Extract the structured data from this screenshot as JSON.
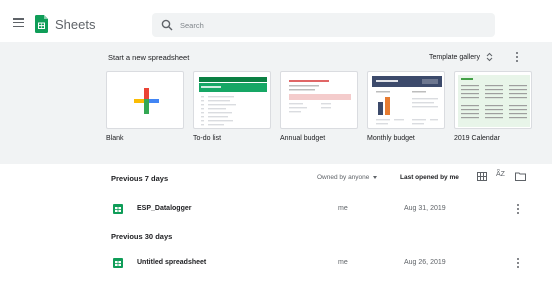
{
  "header": {
    "app_title": "Sheets",
    "search_placeholder": "Search",
    "icons": [
      "menu-icon",
      "sheets-logo-icon",
      "search-icon"
    ]
  },
  "templates": {
    "heading": "Start a new spreadsheet",
    "gallery_label": "Template gallery",
    "items": [
      {
        "label": "Blank",
        "icon": "plus-icon"
      },
      {
        "label": "To-do list"
      },
      {
        "label": "Annual budget"
      },
      {
        "label": "Monthly budget"
      },
      {
        "label": "2019 Calendar"
      }
    ]
  },
  "recent": {
    "owner_filter": "Owned by anyone",
    "sort_label": "Last opened by me",
    "sections": [
      {
        "title": "Previous 7 days",
        "files": [
          {
            "name": "ESP_Datalogger",
            "owner": "me",
            "date": "Aug 31, 2019"
          }
        ]
      },
      {
        "title": "Previous 30 days",
        "files": [
          {
            "name": "Untitled spreadsheet",
            "owner": "me",
            "date": "Aug 26, 2019"
          }
        ]
      }
    ]
  },
  "colors": {
    "sheets_green": "#0f9d58",
    "band_bg": "#f1f3f4",
    "text": "#202124",
    "muted": "#5f6368"
  }
}
